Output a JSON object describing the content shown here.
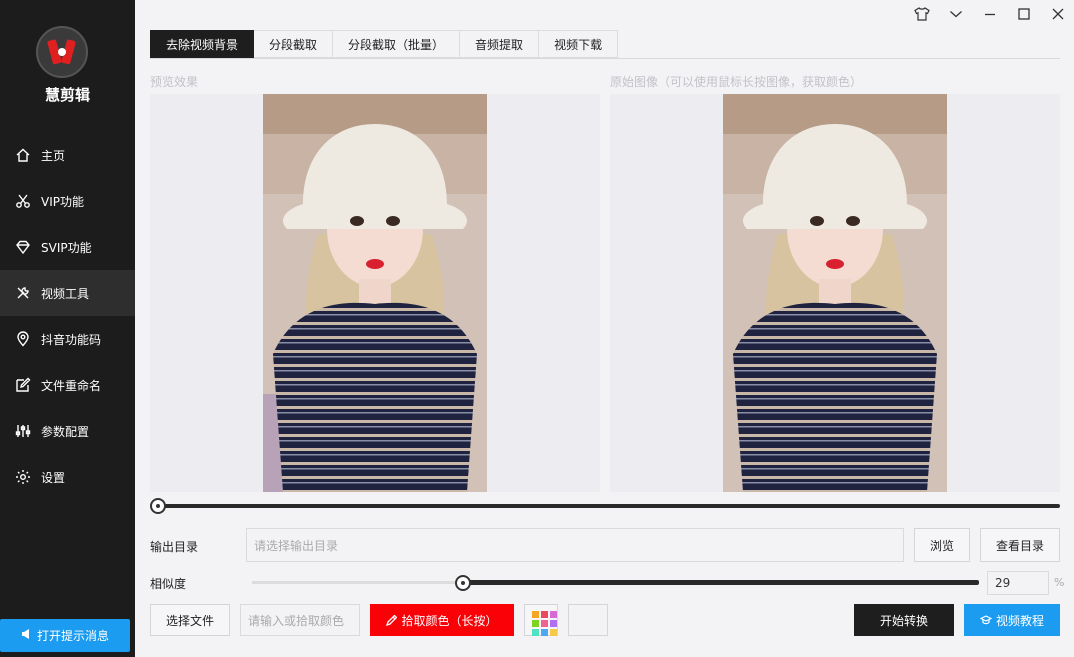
{
  "app": {
    "name": "慧剪辑"
  },
  "sidebar": {
    "items": [
      {
        "label": "主页",
        "icon": "home-icon"
      },
      {
        "label": "VIP功能",
        "icon": "scissors-icon"
      },
      {
        "label": "SVIP功能",
        "icon": "diamond-icon"
      },
      {
        "label": "视频工具",
        "icon": "tools-icon",
        "active": true
      },
      {
        "label": "抖音功能码",
        "icon": "location-pin-icon"
      },
      {
        "label": "文件重命名",
        "icon": "edit-icon"
      },
      {
        "label": "参数配置",
        "icon": "sliders-icon"
      },
      {
        "label": "设置",
        "icon": "gear-icon"
      }
    ],
    "notify_label": "打开提示消息"
  },
  "tabs": [
    {
      "label": "去除视频背景",
      "active": true
    },
    {
      "label": "分段截取"
    },
    {
      "label": "分段截取（批量）"
    },
    {
      "label": "音频提取"
    },
    {
      "label": "视频下载"
    }
  ],
  "preview": {
    "left_label": "预览效果",
    "right_label": "原始图像（可以使用鼠标长按图像，获取颜色）"
  },
  "timeline": {
    "progress": 0
  },
  "output": {
    "label": "输出目录",
    "placeholder": "请选择输出目录",
    "browse_label": "浏览",
    "view_label": "查看目录"
  },
  "similarity": {
    "label": "相似度",
    "value": "29",
    "unit": "%",
    "fraction": 0.29
  },
  "actions": {
    "choose_file": "选择文件",
    "color_placeholder": "请输入或拾取颜色",
    "pick_color": "拾取颜色（长按）",
    "start": "开始转换",
    "tutorial": "视频教程"
  },
  "colors": {
    "accent_blue": "#1b9cf0",
    "pick_red": "#fa0007",
    "dark": "#1e1e1e",
    "sidebar_bg": "#1c1c1c"
  }
}
